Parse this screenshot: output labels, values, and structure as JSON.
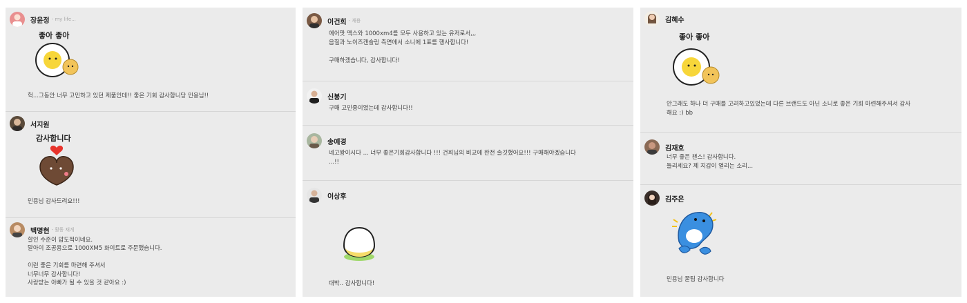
{
  "columns": [
    {
      "comments": [
        {
          "name": "장윤정",
          "sub": "- my life...",
          "sticker": {
            "icon": "chick-sticker-icon",
            "caption": "좋아 좋아"
          },
          "text": "헉...그동안 너무 고민하고 있던 제품인데!! 좋은 기회 감사합니당 민용님!!"
        },
        {
          "name": "서지원",
          "sub": "",
          "sticker": {
            "icon": "heart-bear-sticker-icon",
            "caption": "감사합니다"
          },
          "text": "민용님 감사드려요!!!"
        },
        {
          "name": "백명현",
          "sub": "- 활동 재개",
          "sticker": null,
          "text": "할인 수준이 압도적이네요.\n말아이 조공용으로 1000XM5 화이트로 주문했습니다.\n\n이런 좋은 기회를 마련해 주셔서\n너무너무 감사합니다!\n사랑받는 아빠가 될 수 있을 것 같아요 :)"
        }
      ]
    },
    {
      "comments": [
        {
          "name": "이건희",
          "sub": "- 재용",
          "sticker": null,
          "text": "에어팟 맥스와 1000xm4를 모두 사용하고 있는 유저로서,,,\n음질과 노이즈캔슬링 측면에서 소니에 1표를 행사합니다!\n\n구매하겠습니다, 감사합니다!"
        },
        {
          "name": "신봉기",
          "sub": "",
          "sticker": null,
          "text": "구매 고민중이였는데 감사합니다!!"
        },
        {
          "name": "송예경",
          "sub": "",
          "sticker": null,
          "text": "네고왕이시다 ... 너무 좋은기회감사합니다 !!! 건희님의 비교에 완전 솔깃했어요!!! 구매해야겠습니다\n...!!"
        },
        {
          "name": "이상후",
          "sub": "",
          "sticker": {
            "icon": "egg-sticker-icon",
            "caption": ""
          },
          "text": "대박.. 감사합니다!"
        }
      ]
    },
    {
      "comments": [
        {
          "name": "김혜수",
          "sub": "",
          "sticker": {
            "icon": "chick-sticker-icon",
            "caption": "좋아 좋아"
          },
          "text": "안그래도 하나 더 구매를 고려하고있었는데 다른 브랜드도 아닌 소니로 좋은 기회 마련해주셔서 감사\n해요 :) bb"
        },
        {
          "name": "김재호",
          "sub": "",
          "sticker": null,
          "text": "너무 좋은 챈스! 감사합니다.\n들리세요? 제 지갑이 열리는 소리..."
        },
        {
          "name": "김주은",
          "sub": "",
          "sticker": {
            "icon": "blue-seal-sticker-icon",
            "caption": ""
          },
          "text": "민용님 꿀팁 감사합니다"
        }
      ]
    }
  ],
  "colors": {
    "panel": "#ebebeb",
    "divider": "#d6d6d6",
    "text": "#444444",
    "name": "#222222",
    "sub": "#aaaaaa"
  }
}
